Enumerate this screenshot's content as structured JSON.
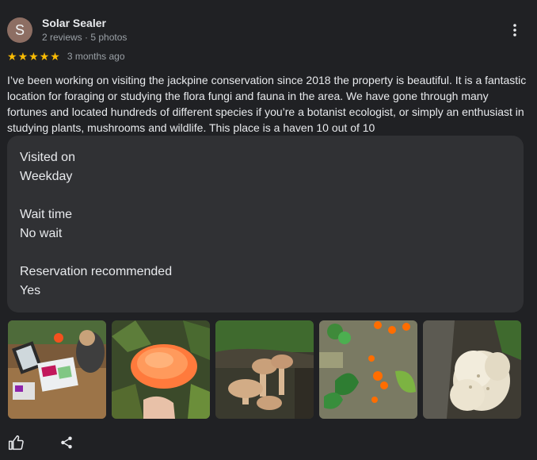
{
  "reviewer": {
    "initial": "S",
    "name": "Solar Sealer",
    "meta": "2 reviews · 5 photos",
    "avatar_color": "#8d6e63"
  },
  "rating": {
    "stars": 5,
    "time": "3 months ago",
    "star_color": "#fbbc04"
  },
  "review_text": "I’ve been working on visiting the jackpine conservation since 2018 the property is beautiful. It is a fantastic location for foraging or studying the flora fungi and fauna in the area. We have gone through many fortunes and located hundreds of different species if you’re a botanist ecologist, or simply an enthusiast in studying plants, mushrooms and wildlife. This place is a haven 10 out of 10",
  "details": {
    "visited_label": "Visited on",
    "visited_value": "Weekday",
    "wait_label": "Wait time",
    "wait_value": "No wait",
    "reservation_label": "Reservation recommended",
    "reservation_value": "Yes"
  },
  "photos": [
    "photo-person-drawing",
    "photo-orange-bracket-fungus",
    "photo-tan-mushrooms",
    "photo-orange-cup-fungi",
    "photo-white-puffball"
  ],
  "actions": {
    "like_icon": "thumb-up-icon",
    "share_icon": "share-icon",
    "more_icon": "more-vert-icon"
  }
}
